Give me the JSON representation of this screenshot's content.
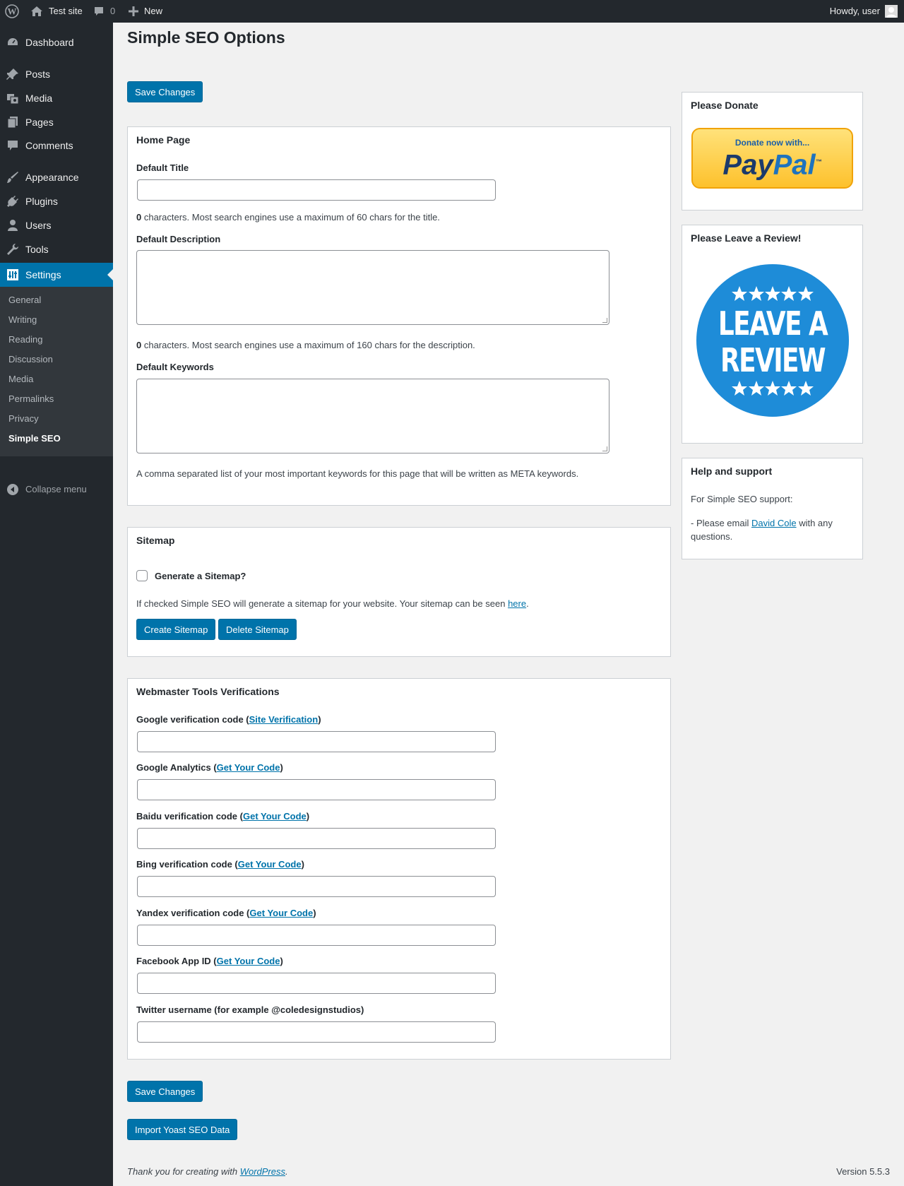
{
  "admin_bar": {
    "site_name": "Test site",
    "comments_count": "0",
    "new_label": "New",
    "howdy": "Howdy, user"
  },
  "sidebar": {
    "items": [
      {
        "label": "Dashboard",
        "icon": "dashboard-icon"
      },
      {
        "label": "Posts",
        "icon": "pin-icon"
      },
      {
        "label": "Media",
        "icon": "media-icon"
      },
      {
        "label": "Pages",
        "icon": "pages-icon"
      },
      {
        "label": "Comments",
        "icon": "comment-icon"
      },
      {
        "label": "Appearance",
        "icon": "brush-icon"
      },
      {
        "label": "Plugins",
        "icon": "plug-icon"
      },
      {
        "label": "Users",
        "icon": "user-icon"
      },
      {
        "label": "Tools",
        "icon": "wrench-icon"
      },
      {
        "label": "Settings",
        "icon": "settings-icon"
      }
    ],
    "submenu": [
      "General",
      "Writing",
      "Reading",
      "Discussion",
      "Media",
      "Permalinks",
      "Privacy",
      "Simple SEO"
    ],
    "collapse_label": "Collapse menu"
  },
  "page": {
    "title": "Simple SEO Options",
    "save_label": "Save Changes",
    "import_label": "Import Yoast SEO Data"
  },
  "home": {
    "title": "Home Page",
    "default_title_label": "Default Title",
    "title_count": "0",
    "title_help": " characters. Most search engines use a maximum of 60 chars for the title.",
    "desc_label": "Default Description",
    "desc_count": "0",
    "desc_help": " characters. Most search engines use a maximum of 160 chars for the description.",
    "keywords_label": "Default Keywords",
    "keywords_help": "A comma separated list of your most important keywords for this page that will be written as META keywords."
  },
  "sitemap": {
    "title": "Sitemap",
    "checkbox_label": "Generate a Sitemap?",
    "help_prefix": "If checked Simple SEO will generate a sitemap for your website. Your sitemap can be seen ",
    "help_link": "here",
    "help_suffix": ".",
    "create_label": "Create Sitemap",
    "delete_label": "Delete Sitemap"
  },
  "webmaster": {
    "title": "Webmaster Tools Verifications",
    "fields": [
      {
        "label": "Google verification code (",
        "link": "Site Verification",
        "suffix": ")"
      },
      {
        "label": "Google Analytics (",
        "link": "Get Your Code",
        "suffix": ")"
      },
      {
        "label": "Baidu verification code (",
        "link": "Get Your Code",
        "suffix": ")"
      },
      {
        "label": "Bing verification code (",
        "link": "Get Your Code",
        "suffix": ")"
      },
      {
        "label": "Yandex verification code (",
        "link": "Get Your Code",
        "suffix": ")"
      },
      {
        "label": "Facebook App ID (",
        "link": "Get Your Code",
        "suffix": ")"
      },
      {
        "label": "Twitter username (for example @coledesignstudios)",
        "link": "",
        "suffix": ""
      }
    ]
  },
  "donate": {
    "title": "Please Donate",
    "paypal_top": "Donate now with...",
    "paypal_brand_a": "Pay",
    "paypal_brand_b": "Pal",
    "paypal_tm": "™"
  },
  "review": {
    "title": "Please Leave a Review!",
    "line1": "LEAVE A",
    "line2": "REVIEW"
  },
  "help": {
    "title": "Help and support",
    "line1": "For Simple SEO support:",
    "line2_prefix": "- Please email ",
    "line2_link": "David Cole",
    "line2_suffix": " with any questions."
  },
  "footer": {
    "thanks_prefix": "Thank you for creating with ",
    "thanks_link": "WordPress",
    "thanks_suffix": ".",
    "version": "Version 5.5.3"
  },
  "colors": {
    "accent": "#0073aa",
    "sidebar_bg": "#23282d",
    "submenu_bg": "#32373c",
    "review_blue": "#1e8cd8"
  }
}
